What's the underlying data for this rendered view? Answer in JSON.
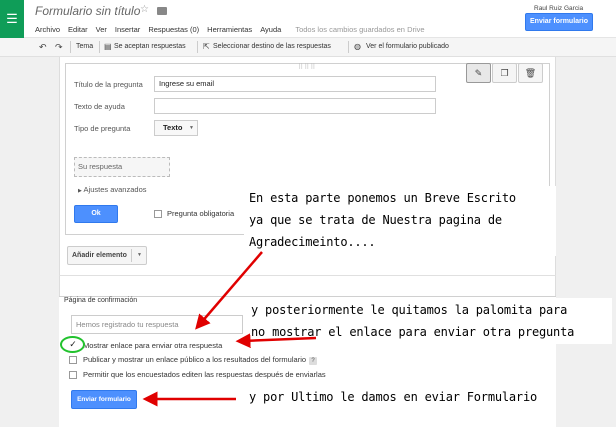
{
  "header": {
    "doc_title": "Formulario sin título",
    "user": "Raul Ruiz Garcia",
    "send_button": "Enviar formulario",
    "menu": [
      "Archivo",
      "Editar",
      "Ver",
      "Insertar",
      "Respuestas (0)",
      "Herramientas",
      "Ayuda"
    ],
    "save_status": "Todos los cambios guardados en Drive",
    "icons": {
      "app": "forms-icon",
      "star": "star-icon",
      "folder": "folder-icon"
    }
  },
  "toolbar": {
    "theme": "Tema",
    "accepting": "Se aceptan respuestas",
    "destination": "Seleccionar destino de las respuestas",
    "view_published": "Ver el formulario publicado"
  },
  "question": {
    "title_label": "Título de la pregunta",
    "title_value": "Ingrese su email",
    "help_label": "Texto de ayuda",
    "help_value": "",
    "type_label": "Tipo de pregunta",
    "type_value": "Texto",
    "answer_placeholder": "Su respuesta",
    "advanced": "Ajustes avanzados",
    "ok": "Ok",
    "required": "Pregunta obligatoria"
  },
  "add_item": "Añadir elemento",
  "confirmation": {
    "title": "Página de confirmación",
    "placeholder": "Hemos registrado tu respuesta",
    "options": [
      {
        "label": "Mostrar enlace para enviar otra respuesta",
        "checked": true
      },
      {
        "label": "Publicar y mostrar un enlace público a los resultados del formulario",
        "checked": false,
        "help": "?"
      },
      {
        "label": "Permitir que los encuestados editen las respuestas después de enviarlas",
        "checked": false
      }
    ],
    "send_button": "Enviar formulario"
  },
  "annotations": {
    "note1": [
      "En esta parte ponemos un Breve Escrito",
      "ya que se trata de Nuestra pagina de",
      "Agradecimeinto...."
    ],
    "note2": [
      "y posteriormente le quitamos la palomita para",
      "no mostrar el enlace para enviar otra pregunta"
    ],
    "note3": "y por Ultimo le damos en eviar Formulario",
    "arrow_color": "#e00000",
    "circle_color": "#22c22e"
  },
  "colors": {
    "accent": "#4d90fe",
    "forms_green": "#0f9d58"
  }
}
